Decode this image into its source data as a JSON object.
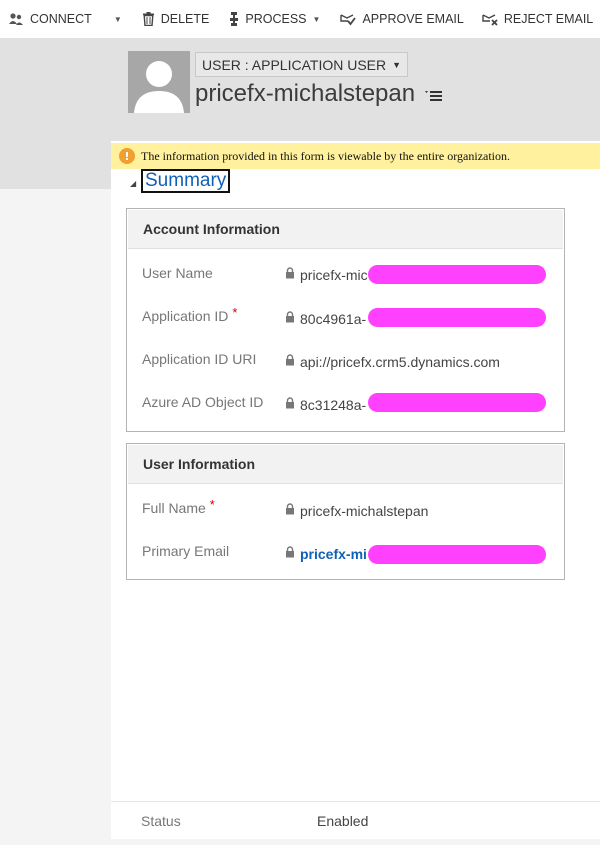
{
  "toolbar": {
    "connect": "CONNECT",
    "delete": "DELETE",
    "process": "PROCESS",
    "approve_email": "APPROVE EMAIL",
    "reject_email": "REJECT EMAIL"
  },
  "header": {
    "entity_form": "USER : APPLICATION USER",
    "record_name": "pricefx-michalstepan"
  },
  "notification": {
    "text": "The information provided in this form is viewable by the entire organization."
  },
  "section": {
    "title": "Summary"
  },
  "account_info": {
    "title": "Account Information",
    "fields": [
      {
        "label": "User Name",
        "value": "pricefx-mic",
        "required": false
      },
      {
        "label": "Application ID",
        "value": "80c4961a-",
        "required": true
      },
      {
        "label": "Application ID URI",
        "value": "api://pricefx.crm5.dynamics.com",
        "required": false
      },
      {
        "label": "Azure AD Object ID",
        "value": "8c31248a-",
        "required": false
      }
    ]
  },
  "user_info": {
    "title": "User Information",
    "fields": [
      {
        "label": "Full Name",
        "value": "pricefx-michalstepan",
        "required": true
      },
      {
        "label": "Primary Email",
        "value": "pricefx-mi",
        "required": false
      }
    ]
  },
  "footer": {
    "status_label": "Status",
    "status_value": "Enabled"
  },
  "colors": {
    "accent": "#1160b7",
    "notification_bg": "#fff19d",
    "redaction": "#ff40ff"
  }
}
